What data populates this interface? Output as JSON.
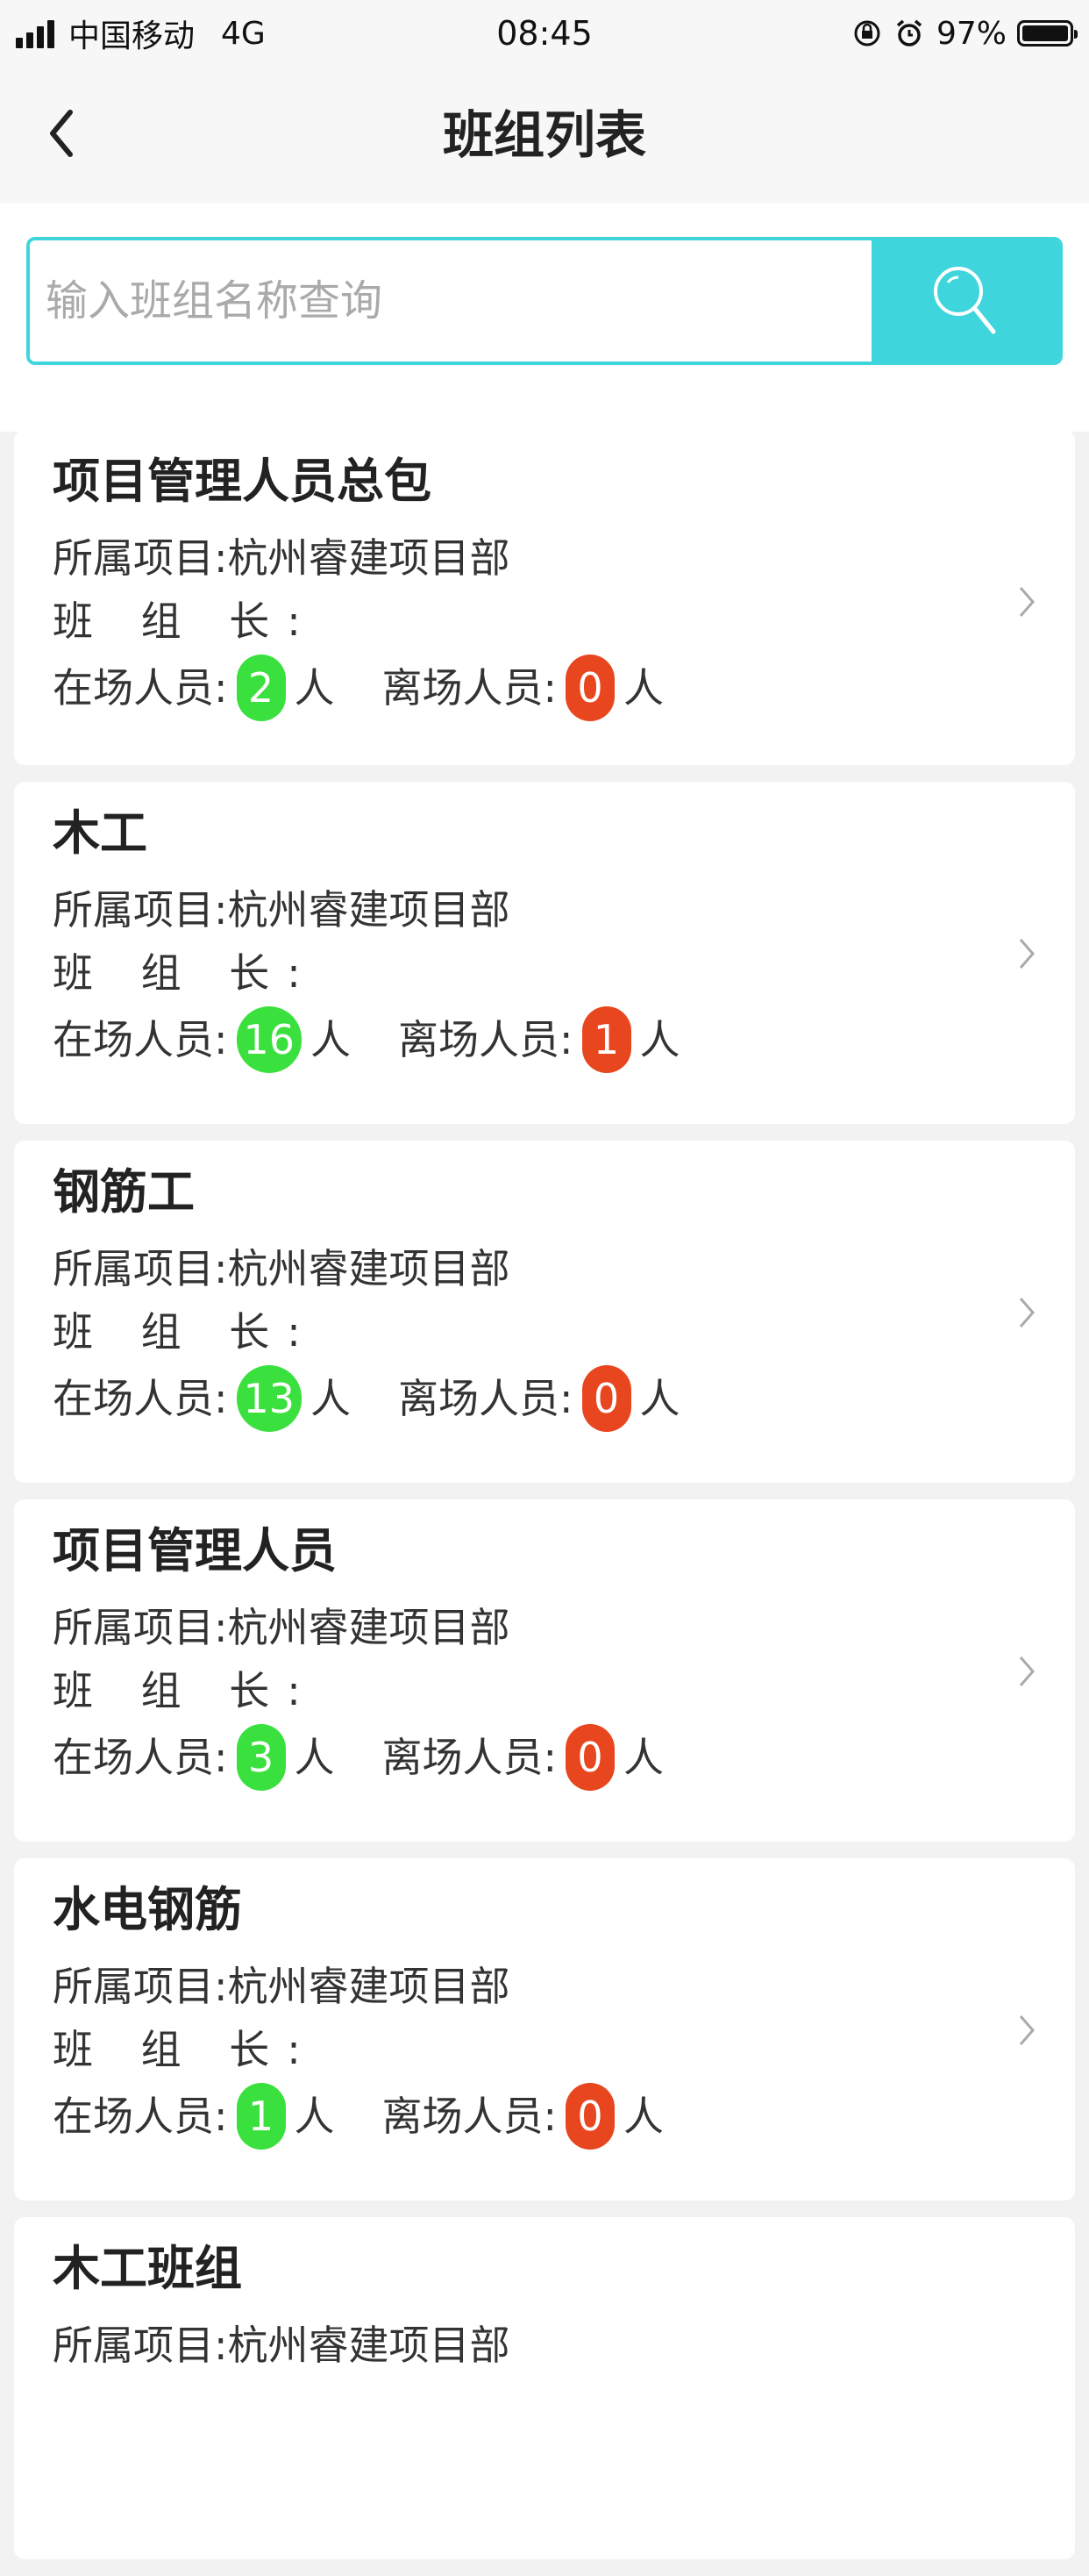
{
  "status_bar": {
    "carrier": "中国移动",
    "network": "4G",
    "time": "08:45",
    "battery": "97%"
  },
  "nav": {
    "title": "班组列表",
    "back_icon": "chevron-left-icon"
  },
  "search": {
    "placeholder": "输入班组名称查询",
    "value": "",
    "icon": "search-icon",
    "accent_color": "#3ed5dc"
  },
  "labels": {
    "project": "所属项目:",
    "leader": "班 组 长:",
    "on_site": "在场人员:",
    "off_site": "离场人员:",
    "unit": "人"
  },
  "colors": {
    "on_site_badge": "#3ae03e",
    "off_site_badge": "#e8461e"
  },
  "teams": [
    {
      "name": "项目管理人员总包",
      "project": "杭州睿建项目部",
      "leader": "",
      "on_site": "2",
      "off_site": "0"
    },
    {
      "name": "木工",
      "project": "杭州睿建项目部",
      "leader": "",
      "on_site": "16",
      "off_site": "1"
    },
    {
      "name": "钢筋工",
      "project": "杭州睿建项目部",
      "leader": "",
      "on_site": "13",
      "off_site": "0"
    },
    {
      "name": "项目管理人员",
      "project": "杭州睿建项目部",
      "leader": "",
      "on_site": "3",
      "off_site": "0"
    },
    {
      "name": "水电钢筋",
      "project": "杭州睿建项目部",
      "leader": "",
      "on_site": "1",
      "off_site": "0"
    },
    {
      "name": "木工班组",
      "project": "杭州睿建项目部",
      "leader": "",
      "on_site": "",
      "off_site": ""
    }
  ]
}
